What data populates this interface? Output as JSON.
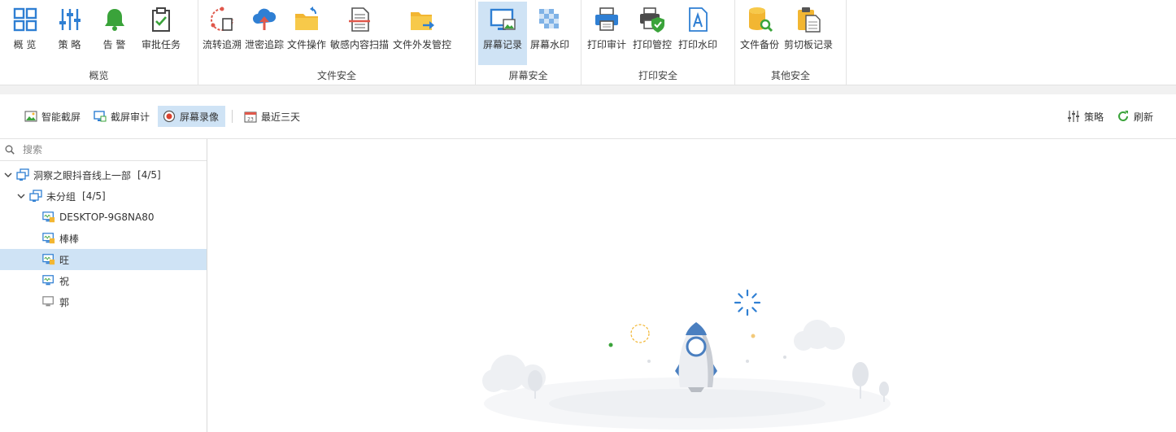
{
  "ribbon": {
    "groups": [
      {
        "label": "概览",
        "items": [
          {
            "label": "概 览",
            "icon": "grid-icon"
          },
          {
            "label": "策 略",
            "icon": "sliders-icon"
          },
          {
            "label": "告 警",
            "icon": "bell-icon"
          },
          {
            "label": "审批任务",
            "icon": "clipboard-check-icon"
          }
        ]
      },
      {
        "label": "文件安全",
        "items": [
          {
            "label": "流转追溯",
            "icon": "flow-trace-icon"
          },
          {
            "label": "泄密追踪",
            "icon": "cloud-upload-icon"
          },
          {
            "label": "文件操作",
            "icon": "folder-arrow-icon"
          },
          {
            "label": "敏感内容扫描",
            "icon": "document-scan-icon"
          },
          {
            "label": "文件外发管控",
            "icon": "folder-send-icon"
          }
        ]
      },
      {
        "label": "屏幕安全",
        "items": [
          {
            "label": "屏幕记录",
            "icon": "monitor-image-icon",
            "active": true
          },
          {
            "label": "屏幕水印",
            "icon": "checker-watermark-icon"
          }
        ]
      },
      {
        "label": "打印安全",
        "items": [
          {
            "label": "打印审计",
            "icon": "printer-icon"
          },
          {
            "label": "打印管控",
            "icon": "printer-shield-icon"
          },
          {
            "label": "打印水印",
            "icon": "letter-a-doc-icon"
          }
        ]
      },
      {
        "label": "其他安全",
        "items": [
          {
            "label": "文件备份",
            "icon": "database-search-icon"
          },
          {
            "label": "剪切板记录",
            "icon": "clipboard-doc-icon"
          }
        ]
      }
    ]
  },
  "toolbar": {
    "smart_capture": "智能截屏",
    "capture_audit": "截屏审计",
    "screen_recording": "屏幕录像",
    "date_range": "最近三天",
    "policy": "策略",
    "refresh": "刷新"
  },
  "sidebar": {
    "search_placeholder": "搜索",
    "root": {
      "label": "洞察之眼抖音线上一部",
      "count": "[4/5]"
    },
    "group": {
      "label": "未分组",
      "count": "[4/5]"
    },
    "devices": [
      {
        "label": "DESKTOP-9G8NA80",
        "status": "online-locked"
      },
      {
        "label": "棒棒",
        "status": "online-locked"
      },
      {
        "label": "旺",
        "status": "online-locked",
        "selected": true
      },
      {
        "label": "祝",
        "status": "online"
      },
      {
        "label": "郭",
        "status": "offline"
      }
    ]
  },
  "colors": {
    "accent": "#2f7fd3",
    "selected_bg": "#cfe3f5",
    "offline_gray": "#8a8a8a",
    "lock_yellow": "#f2b632"
  }
}
